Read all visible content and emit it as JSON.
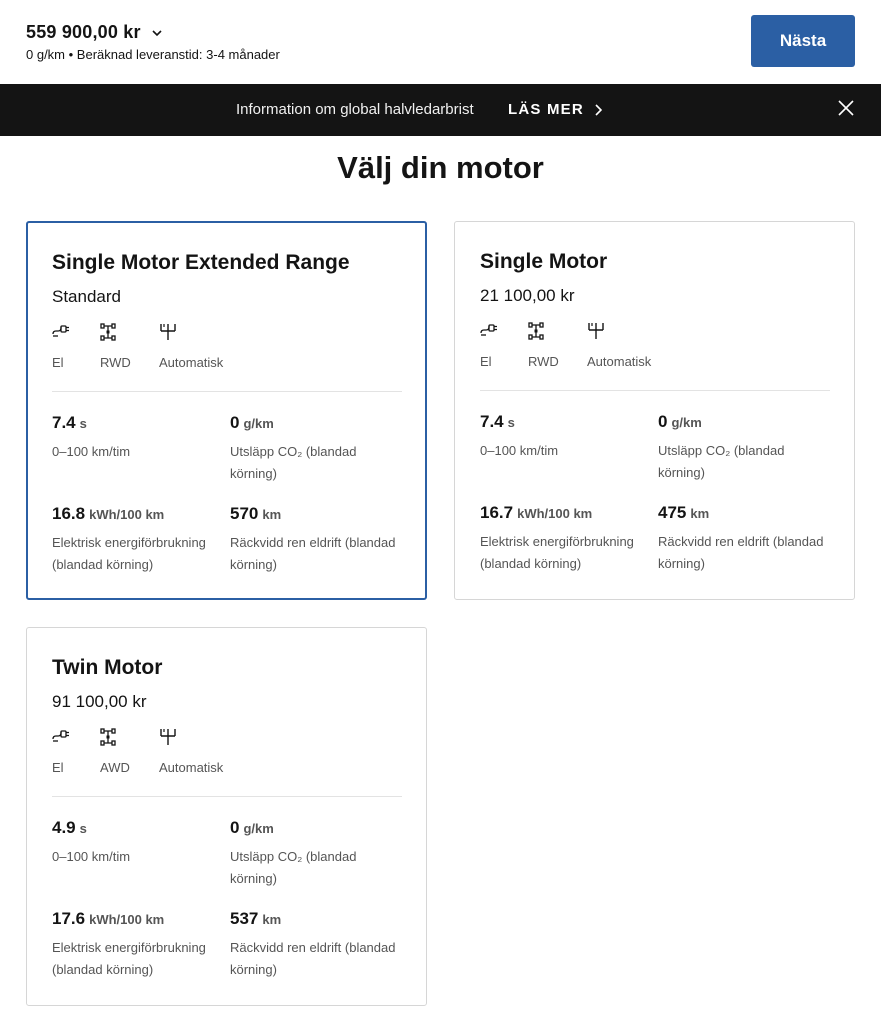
{
  "header": {
    "price": "559 900,00 kr",
    "subtitle": "0 g/km • Beräknad leveranstid: 3-4 månader",
    "next_label": "Nästa"
  },
  "banner": {
    "text": "Information om global halvledarbrist",
    "link_label": "LÄS MER"
  },
  "page": {
    "heading": "Välj din motor"
  },
  "motors": [
    {
      "title": "Single Motor Extended Range",
      "price": "Standard",
      "selected": true,
      "features": [
        {
          "icon": "electric-plug-icon",
          "label": "El"
        },
        {
          "icon": "drivetrain-icon",
          "label": "RWD"
        },
        {
          "icon": "gearbox-icon",
          "label": "Automatisk"
        }
      ],
      "specs": [
        {
          "value": "7.4",
          "unit": "s",
          "label": "0–100 km/tim"
        },
        {
          "value": "0",
          "unit": "g/km",
          "label": "Utsläpp CO₂ (blandad körning)"
        },
        {
          "value": "16.8",
          "unit": "kWh/100 km",
          "label": "Elektrisk energiförbrukning (blandad körning)"
        },
        {
          "value": "570",
          "unit": "km",
          "label": "Räckvidd ren eldrift (blandad körning)"
        }
      ]
    },
    {
      "title": "Single Motor",
      "price": "21 100,00 kr",
      "selected": false,
      "features": [
        {
          "icon": "electric-plug-icon",
          "label": "El"
        },
        {
          "icon": "drivetrain-icon",
          "label": "RWD"
        },
        {
          "icon": "gearbox-icon",
          "label": "Automatisk"
        }
      ],
      "specs": [
        {
          "value": "7.4",
          "unit": "s",
          "label": "0–100 km/tim"
        },
        {
          "value": "0",
          "unit": "g/km",
          "label": "Utsläpp CO₂ (blandad körning)"
        },
        {
          "value": "16.7",
          "unit": "kWh/100 km",
          "label": "Elektrisk energiförbrukning (blandad körning)"
        },
        {
          "value": "475",
          "unit": "km",
          "label": "Räckvidd ren eldrift (blandad körning)"
        }
      ]
    },
    {
      "title": "Twin Motor",
      "price": "91 100,00 kr",
      "selected": false,
      "features": [
        {
          "icon": "electric-plug-icon",
          "label": "El"
        },
        {
          "icon": "drivetrain-icon",
          "label": "AWD"
        },
        {
          "icon": "gearbox-icon",
          "label": "Automatisk"
        }
      ],
      "specs": [
        {
          "value": "4.9",
          "unit": "s",
          "label": "0–100 km/tim"
        },
        {
          "value": "0",
          "unit": "g/km",
          "label": "Utsläpp CO₂ (blandad körning)"
        },
        {
          "value": "17.6",
          "unit": "kWh/100 km",
          "label": "Elektrisk energiförbrukning (blandad körning)"
        },
        {
          "value": "537",
          "unit": "km",
          "label": "Räckvidd ren eldrift (blandad körning)"
        }
      ]
    }
  ],
  "colors": {
    "accent": "#2b5fa4",
    "banner_bg": "#141414",
    "text": "#141414",
    "muted": "#555555",
    "border": "#d6d6d6"
  }
}
